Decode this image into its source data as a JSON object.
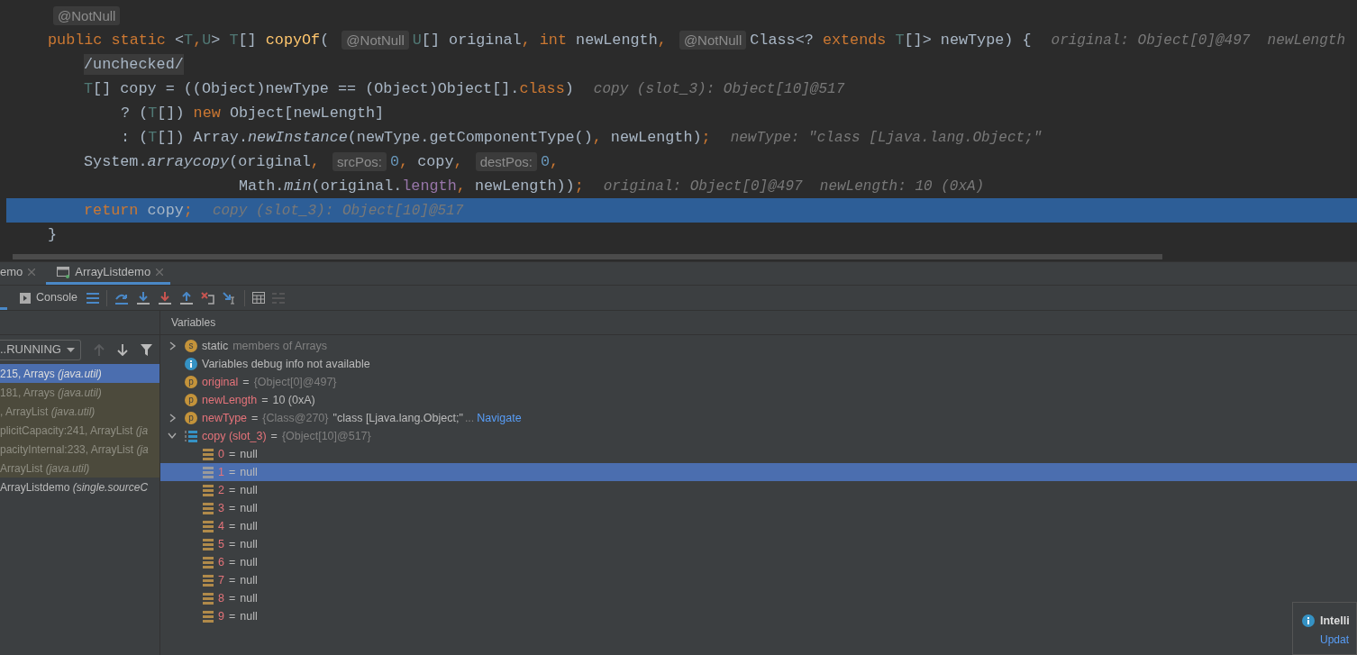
{
  "editor": {
    "lines": [
      {
        "kind": "annotation",
        "current": false,
        "tokens": [
          {
            "kind": "ann",
            "text": "@NotNull"
          }
        ]
      },
      {
        "kind": "signature",
        "current": false,
        "tokens": [
          {
            "kind": "kw",
            "text": "public static "
          },
          {
            "kind": "pl",
            "text": "<"
          },
          {
            "kind": "tp",
            "text": "T"
          },
          {
            "kind": "kw",
            "text": ","
          },
          {
            "kind": "tp",
            "text": "U"
          },
          {
            "kind": "pl",
            "text": "> "
          },
          {
            "kind": "tp",
            "text": "T"
          },
          {
            "kind": "pl",
            "text": "[] "
          },
          {
            "kind": "fn",
            "text": "copyOf"
          },
          {
            "kind": "pl",
            "text": "( "
          },
          {
            "kind": "ann",
            "text": "@NotNull"
          },
          {
            "kind": "tp",
            "text": "U"
          },
          {
            "kind": "pl",
            "text": "[] original"
          },
          {
            "kind": "kw",
            "text": ", int "
          },
          {
            "kind": "pl",
            "text": "newLength"
          },
          {
            "kind": "kw",
            "text": ", "
          },
          {
            "kind": "ann",
            "text": "@NotNull"
          },
          {
            "kind": "pl",
            "text": "Class<? "
          },
          {
            "kind": "kw",
            "text": "extends "
          },
          {
            "kind": "tp",
            "text": "T"
          },
          {
            "kind": "pl",
            "text": "[]> newType) {"
          },
          {
            "kind": "val",
            "text": "original: Object[0]@497  newLength"
          }
        ]
      },
      {
        "kind": "statement",
        "current": false,
        "tokens": [
          {
            "kind": "fold",
            "text": "/unchecked/"
          }
        ]
      },
      {
        "kind": "statement",
        "current": false,
        "tokens": [
          {
            "kind": "tp",
            "text": "T"
          },
          {
            "kind": "pl",
            "text": "[] copy = ((Object)newType == (Object)Object[]."
          },
          {
            "kind": "kw",
            "text": "class"
          },
          {
            "kind": "pl",
            "text": ")"
          },
          {
            "kind": "val",
            "text": "copy (slot_3): Object[10]@517"
          }
        ]
      },
      {
        "kind": "continuation",
        "current": false,
        "tokens": [
          {
            "kind": "pl",
            "text": "? ("
          },
          {
            "kind": "tp",
            "text": "T"
          },
          {
            "kind": "pl",
            "text": "[]) "
          },
          {
            "kind": "kw",
            "text": "new "
          },
          {
            "kind": "pl",
            "text": "Object[newLength]"
          }
        ]
      },
      {
        "kind": "continuation",
        "current": false,
        "tokens": [
          {
            "kind": "pl",
            "text": ": ("
          },
          {
            "kind": "tp",
            "text": "T"
          },
          {
            "kind": "pl",
            "text": "[]) Array."
          },
          {
            "kind": "it",
            "text": "newInstance"
          },
          {
            "kind": "pl",
            "text": "(newType.getComponentType()"
          },
          {
            "kind": "kw",
            "text": ", "
          },
          {
            "kind": "pl",
            "text": "newLength)"
          },
          {
            "kind": "kw",
            "text": ";"
          },
          {
            "kind": "val",
            "text": "newType: \"class [Ljava.lang.Object;\""
          }
        ]
      },
      {
        "kind": "statement",
        "current": false,
        "tokens": [
          {
            "kind": "pl",
            "text": "System."
          },
          {
            "kind": "it",
            "text": "arraycopy"
          },
          {
            "kind": "pl",
            "text": "(original"
          },
          {
            "kind": "kw",
            "text": ", "
          },
          {
            "kind": "hint",
            "text": "srcPos:"
          },
          {
            "kind": "num",
            "text": "0"
          },
          {
            "kind": "kw",
            "text": ", "
          },
          {
            "kind": "pl",
            "text": "copy"
          },
          {
            "kind": "kw",
            "text": ", "
          },
          {
            "kind": "hint",
            "text": "destPos:"
          },
          {
            "kind": "num",
            "text": "0"
          },
          {
            "kind": "kw",
            "text": ","
          }
        ]
      },
      {
        "kind": "aligned",
        "current": false,
        "tokens": [
          {
            "kind": "pl",
            "text": "Math."
          },
          {
            "kind": "it",
            "text": "min"
          },
          {
            "kind": "pl",
            "text": "(original."
          },
          {
            "kind": "fld",
            "text": "length"
          },
          {
            "kind": "kw",
            "text": ", "
          },
          {
            "kind": "pl",
            "text": "newLength))"
          },
          {
            "kind": "kw",
            "text": ";"
          },
          {
            "kind": "val",
            "text": "original: Object[0]@497  newLength: 10 (0xA)"
          }
        ]
      },
      {
        "kind": "statement",
        "current": true,
        "tokens": [
          {
            "kind": "kw",
            "text": "return "
          },
          {
            "kind": "pl",
            "text": "copy"
          },
          {
            "kind": "kw",
            "text": ";"
          },
          {
            "kind": "val",
            "text": "copy (slot_3): Object[10]@517"
          }
        ]
      },
      {
        "kind": "signature",
        "current": false,
        "tokens": [
          {
            "kind": "pl",
            "text": "}"
          }
        ]
      }
    ]
  },
  "debug_tabs": [
    {
      "label": "emo",
      "selected": false
    },
    {
      "label": "ArrayListdemo",
      "selected": true
    }
  ],
  "toolbar": {
    "console_label": "Console"
  },
  "frames": {
    "thread_filter": "..RUNNING",
    "items": [
      {
        "text": "215, Arrays *(java.util)*",
        "selected": true,
        "library": true
      },
      {
        "text": "181, Arrays *(java.util)*",
        "selected": false,
        "library": true
      },
      {
        "text": ", ArrayList *(java.util)*",
        "selected": false,
        "library": true
      },
      {
        "text": "plicitCapacity:241, ArrayList *(ja*",
        "selected": false,
        "library": true
      },
      {
        "text": "pacityInternal:233, ArrayList *(ja*",
        "selected": false,
        "library": true
      },
      {
        "text": "ArrayList *(java.util)*",
        "selected": false,
        "library": true
      },
      {
        "text": "ArrayListdemo *(single.sourceC*",
        "selected": false,
        "library": false
      }
    ]
  },
  "variables": {
    "title": "Variables",
    "items": [
      {
        "kind": "static",
        "icon_letter": "s",
        "name": "static",
        "detail": "members of Arrays",
        "expanded": false,
        "selected": false
      },
      {
        "kind": "info",
        "name": "Variables debug info not available",
        "selected": false
      },
      {
        "kind": "param",
        "icon_letter": "p",
        "name": "original",
        "sep": "=",
        "ref": "{Object[0]@497}",
        "selected": false
      },
      {
        "kind": "param",
        "icon_letter": "p",
        "name": "newLength",
        "sep": "=",
        "value": "10 (0xA)",
        "selected": false
      },
      {
        "kind": "param",
        "icon_letter": "p",
        "name": "newType",
        "sep": "=",
        "ref": "{Class@270}",
        "value": "\"class [Ljava.lang.Object;\"",
        "truncation": "...",
        "link": "Navigate",
        "expanded": false,
        "selected": false
      },
      {
        "kind": "array",
        "name": "copy (slot_3)",
        "sep": "=",
        "ref": "{Object[10]@517}",
        "expanded": true,
        "selected": false,
        "children": [
          {
            "kind": "element",
            "name": "0",
            "sep": "=",
            "value": "null",
            "selected": false
          },
          {
            "kind": "element",
            "name": "1",
            "sep": "=",
            "value": "null",
            "selected": true
          },
          {
            "kind": "element",
            "name": "2",
            "sep": "=",
            "value": "null",
            "selected": false
          },
          {
            "kind": "element",
            "name": "3",
            "sep": "=",
            "value": "null",
            "selected": false
          },
          {
            "kind": "element",
            "name": "4",
            "sep": "=",
            "value": "null",
            "selected": false
          },
          {
            "kind": "element",
            "name": "5",
            "sep": "=",
            "value": "null",
            "selected": false
          },
          {
            "kind": "element",
            "name": "6",
            "sep": "=",
            "value": "null",
            "selected": false
          },
          {
            "kind": "element",
            "name": "7",
            "sep": "=",
            "value": "null",
            "selected": false
          },
          {
            "kind": "element",
            "name": "8",
            "sep": "=",
            "value": "null",
            "selected": false
          },
          {
            "kind": "element",
            "name": "9",
            "sep": "=",
            "value": "null",
            "selected": false
          }
        ]
      }
    ]
  },
  "notification": {
    "title": "Intelli",
    "link": "Updat"
  }
}
